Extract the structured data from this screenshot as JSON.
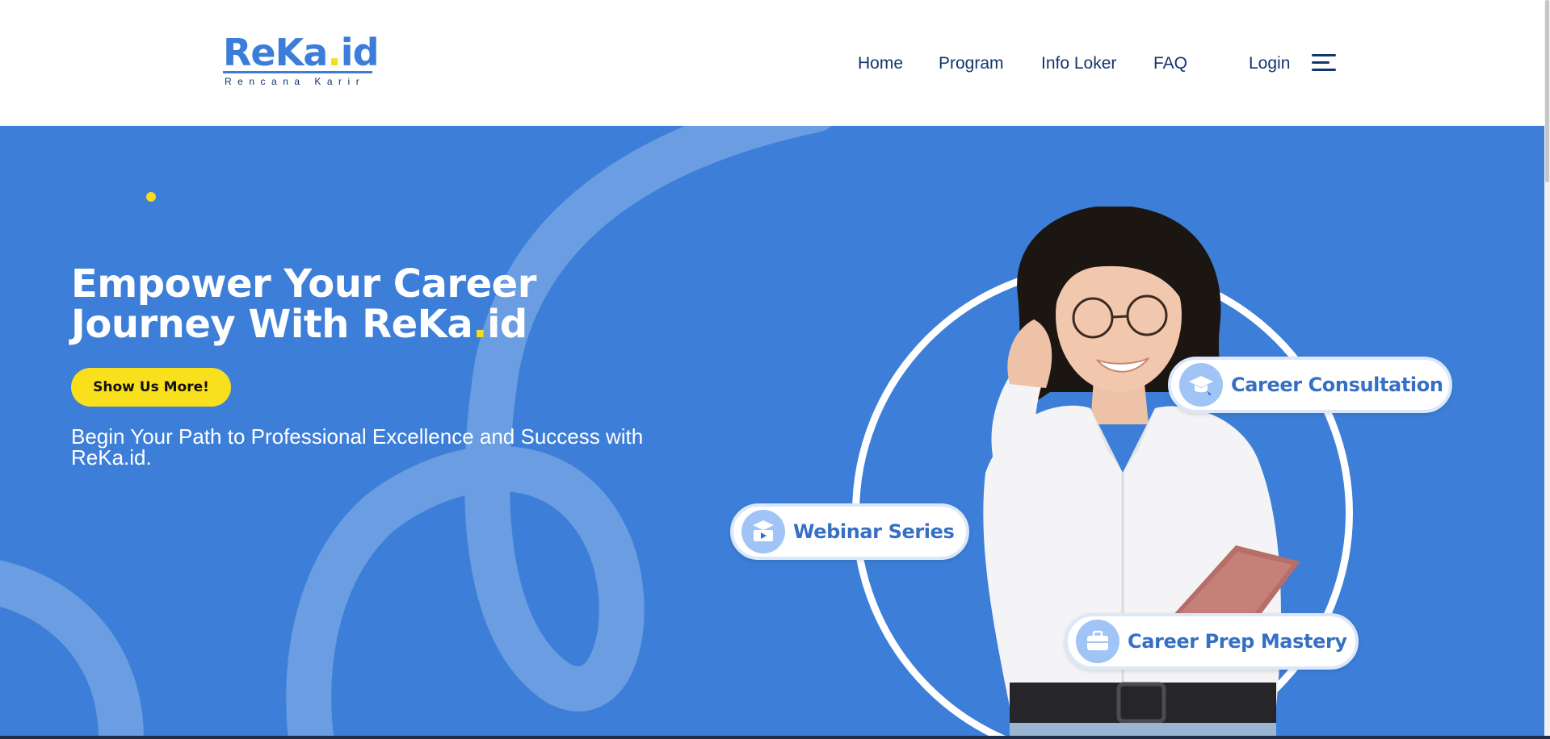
{
  "header": {
    "logo": {
      "brand_main": "ReKa",
      "brand_dot": ".",
      "brand_tld": "id",
      "tagline": "Rencana Karir"
    },
    "nav": [
      {
        "label": "Home"
      },
      {
        "label": "Program"
      },
      {
        "label": "Info Loker"
      },
      {
        "label": "FAQ"
      }
    ],
    "login_label": "Login",
    "menu_icon": "hamburger-menu-icon"
  },
  "hero": {
    "title_line1": "Empower Your Career",
    "title_line2_prefix": "Journey With ReKa",
    "title_line2_dot": ".",
    "title_line2_suffix": "id",
    "cta_label": "Show Us More!",
    "subtitle": "Begin Your Path to Professional Excellence and Success with ReKa.id.",
    "features": [
      {
        "label": "Career Consultation",
        "icon": "graduation-cap-icon"
      },
      {
        "label": "Webinar Series",
        "icon": "video-lesson-icon"
      },
      {
        "label": "Career Prep Mastery",
        "icon": "briefcase-icon"
      }
    ]
  },
  "colors": {
    "brand_blue": "#3b7dd8",
    "hero_background": "#3d7fd8",
    "accent_yellow": "#f9e01c",
    "nav_text": "#12356e",
    "pill_text": "#3570c4"
  }
}
